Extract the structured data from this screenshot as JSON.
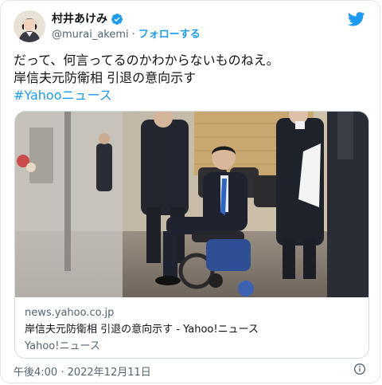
{
  "tweet": {
    "author_name": "村井あけみ",
    "handle": "@murai_akemi",
    "separator": "·",
    "follow_label": "フォローする",
    "text_line1": "だって、何言ってるのかわからないものねえ。",
    "text_line2": "岸信夫元防衛相 引退の意向示す",
    "hashtag": "#Yahooニュース",
    "timestamp": "午後4:00 · 2022年12月11日"
  },
  "link_card": {
    "site": "news.yahoo.co.jp",
    "title": "岸信夫元防衛相 引退の意向示す - Yahoo!ニュース",
    "source": "Yahoo!ニュース"
  },
  "colors": {
    "accent": "#1d9bf0",
    "text": "#0f1419",
    "muted": "#536471",
    "border": "#cfd9de"
  },
  "icons": {
    "verified": "verified-badge-icon",
    "brand": "twitter-bird-icon",
    "info": "info-circle-icon"
  }
}
